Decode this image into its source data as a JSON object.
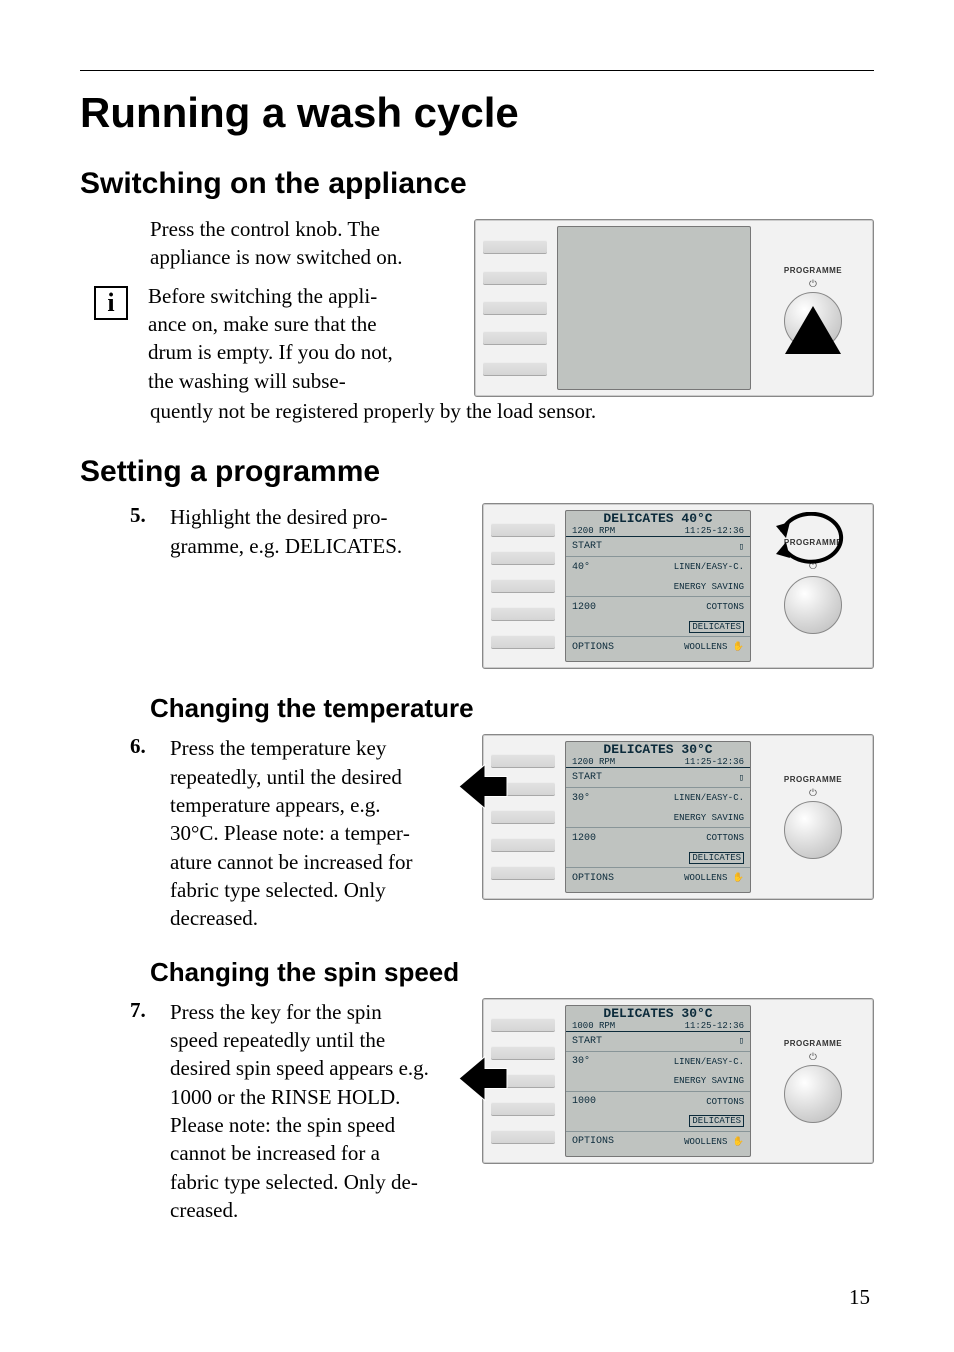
{
  "page_number": "15",
  "title": "Running a wash cycle",
  "section1": {
    "heading": "Switching on the appliance",
    "para1": "Press the control knob. The appliance is now switched on.",
    "para2": "Before switching the appli­ance on, make sure that the drum is empty. If you do not, the washing will subse­quently not be registered properly by the load sensor.",
    "knob_label": "PROGRAMME"
  },
  "section2": {
    "heading": "Setting a programme",
    "step_num": "5.",
    "step_text": "Highlight the desired pro­gramme, e.g. DELICATES.",
    "screen": {
      "title": "DELICATES 40°C",
      "rpm": "1200 RPM",
      "time": "11:25-12:36",
      "rows": [
        {
          "l": "START",
          "r": ""
        },
        {
          "l": "40°",
          "r1": "LINEN/EASY-C.",
          "r2": "ENERGY SAVING"
        },
        {
          "l": "1200",
          "r1": "COTTONS",
          "r2_boxed": "DELICATES"
        },
        {
          "l": "OPTIONS",
          "r": "WOOLLENS"
        }
      ]
    },
    "knob_label": "PROGRAMME"
  },
  "section3": {
    "heading": "Changing the temperature",
    "step_num": "6.",
    "step_text": "Press the temperature key repeatedly, until the desired temperature appears, e.g. 30°C. Please note: a temper­ature cannot be increased for fabric type selected. Only decreased.",
    "screen": {
      "title": "DELICATES 30°C",
      "rpm": "1200 RPM",
      "time": "11:25-12:36",
      "rows": [
        {
          "l": "START",
          "r": ""
        },
        {
          "l": "30°",
          "r1": "LINEN/EASY-C.",
          "r2": "ENERGY SAVING"
        },
        {
          "l": "1200",
          "r1": "COTTONS",
          "r2_boxed": "DELICATES"
        },
        {
          "l": "OPTIONS",
          "r": "WOOLLENS"
        }
      ]
    },
    "knob_label": "PROGRAMME",
    "press_row": 1
  },
  "section4": {
    "heading": "Changing the spin speed",
    "step_num": "7.",
    "step_text": "Press the key for the spin speed repeatedly until the desired spin speed appears e.g. 1000 or the RINSE HOLD. Please note: the spin speed cannot be increased for a fabric type selected. Only de­creased.",
    "screen": {
      "title": "DELICATES 30°C",
      "rpm": "1000 RPM",
      "time": "11:25-12:36",
      "rows": [
        {
          "l": "START",
          "r": ""
        },
        {
          "l": "30°",
          "r1": "LINEN/EASY-C.",
          "r2": "ENERGY SAVING"
        },
        {
          "l": "1000",
          "r1": "COTTONS",
          "r2_boxed": "DELICATES"
        },
        {
          "l": "OPTIONS",
          "r": "WOOLLENS"
        }
      ]
    },
    "knob_label": "PROGRAMME",
    "press_row": 2
  }
}
